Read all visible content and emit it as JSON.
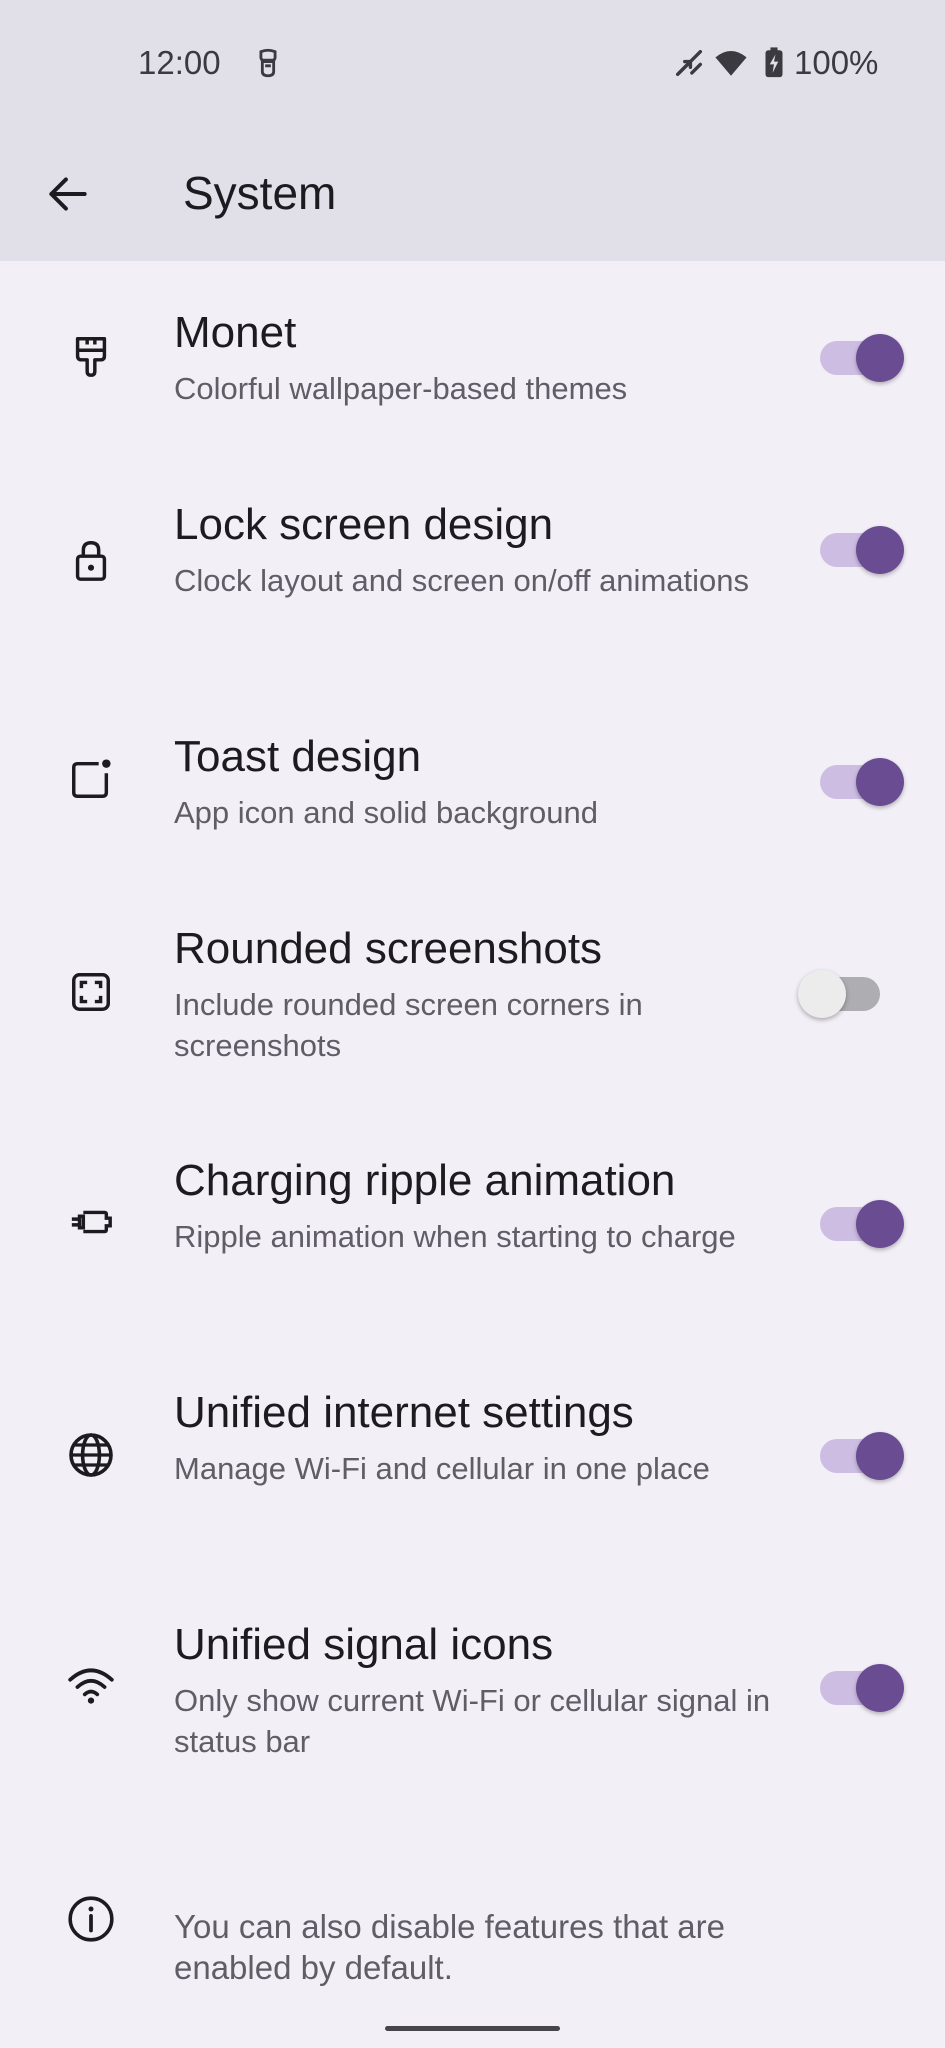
{
  "status_bar": {
    "time": "12:00",
    "battery": "100%",
    "icons": [
      "notification-app-icon",
      "call-muted-icon",
      "wifi-icon",
      "battery-charging-icon"
    ]
  },
  "app_bar": {
    "title": "System",
    "back_icon": "arrow-back-icon"
  },
  "settings": [
    {
      "title": "Monet",
      "summary": "Colorful wallpaper-based themes",
      "enabled": true,
      "icon": "paintbrush-icon"
    },
    {
      "title": "Lock screen design",
      "summary": "Clock layout and screen on/off animations",
      "enabled": true,
      "icon": "lock-icon"
    },
    {
      "title": "Toast design",
      "summary": "App icon and solid background",
      "enabled": true,
      "icon": "toast-icon"
    },
    {
      "title": "Rounded screenshots",
      "summary": "Include rounded screen corners in screenshots",
      "enabled": false,
      "icon": "screenshot-icon"
    },
    {
      "title": "Charging ripple animation",
      "summary": "Ripple animation when starting to charge",
      "enabled": true,
      "icon": "charging-plug-icon"
    },
    {
      "title": "Unified internet settings",
      "summary": "Manage Wi-Fi and cellular in one place",
      "enabled": true,
      "icon": "globe-icon"
    },
    {
      "title": "Unified signal icons",
      "summary": "Only show current Wi-Fi or cellular signal in status bar",
      "enabled": true,
      "icon": "wifi-icon"
    }
  ],
  "info": {
    "icon": "info-icon",
    "text": "You can also disable features that are enabled by default."
  },
  "colors": {
    "accent": "#6a4c93",
    "accent_track": "#cdbde3",
    "background": "#f3eff7",
    "bar_background": "#e1e0e9"
  }
}
